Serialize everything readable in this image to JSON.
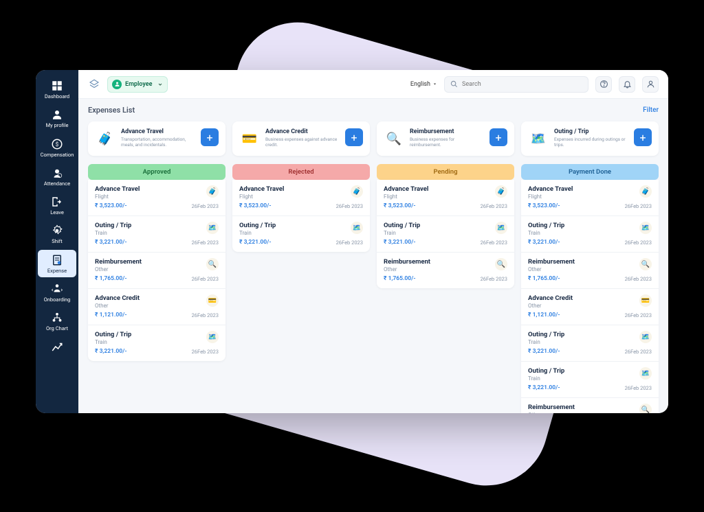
{
  "topbar": {
    "role": "Employee",
    "language": "English",
    "search_placeholder": "Search"
  },
  "sidebar": {
    "items": [
      {
        "label": "Dashboard"
      },
      {
        "label": "My profile"
      },
      {
        "label": "Compensation"
      },
      {
        "label": "Attendance"
      },
      {
        "label": "Leave"
      },
      {
        "label": "Shift"
      },
      {
        "label": "Expense"
      },
      {
        "label": "Onboarding"
      },
      {
        "label": "Org Chart"
      }
    ]
  },
  "page": {
    "title": "Expenses List",
    "filter": "Filter"
  },
  "categories": [
    {
      "title": "Advance Travel",
      "desc": "Transportation, accommodation, meals, and incidentals."
    },
    {
      "title": "Advance Credit",
      "desc": "Business expenses against advance credit."
    },
    {
      "title": "Reimbursement",
      "desc": "Business expenses for reimbursement."
    },
    {
      "title": "Outing / Trip",
      "desc": "Expenses incurred during outings or trips."
    }
  ],
  "columns": [
    {
      "name": "Approved",
      "items": [
        {
          "title": "Advance Travel",
          "sub": "Flight",
          "amount": "₹ 3,523.00/-",
          "date": "26Feb 2023"
        },
        {
          "title": "Outing / Trip",
          "sub": "Train",
          "amount": "₹ 3,221.00/-",
          "date": "26Feb 2023"
        },
        {
          "title": "Reimbursement",
          "sub": "Other",
          "amount": "₹ 1,765.00/-",
          "date": "26Feb 2023"
        },
        {
          "title": "Advance Credit",
          "sub": "Other",
          "amount": "₹ 1,121.00/-",
          "date": "26Feb 2023"
        },
        {
          "title": "Outing / Trip",
          "sub": "Train",
          "amount": "₹ 3,221.00/-",
          "date": "26Feb 2023"
        }
      ]
    },
    {
      "name": "Rejected",
      "items": [
        {
          "title": "Advance Travel",
          "sub": "Flight",
          "amount": "₹ 3,523.00/-",
          "date": "26Feb 2023"
        },
        {
          "title": "Outing / Trip",
          "sub": "Train",
          "amount": "₹ 3,221.00/-",
          "date": "26Feb 2023"
        }
      ]
    },
    {
      "name": "Pending",
      "items": [
        {
          "title": "Advance Travel",
          "sub": "Flight",
          "amount": "₹ 3,523.00/-",
          "date": "26Feb 2023"
        },
        {
          "title": "Outing / Trip",
          "sub": "Train",
          "amount": "₹ 3,221.00/-",
          "date": "26Feb 2023"
        },
        {
          "title": "Reimbursement",
          "sub": "Other",
          "amount": "₹ 1,765.00/-",
          "date": "26Feb 2023"
        }
      ]
    },
    {
      "name": "Payment Done",
      "items": [
        {
          "title": "Advance Travel",
          "sub": "Flight",
          "amount": "₹ 3,523.00/-",
          "date": "26Feb 2023"
        },
        {
          "title": "Outing / Trip",
          "sub": "Train",
          "amount": "₹ 3,221.00/-",
          "date": "26Feb 2023"
        },
        {
          "title": "Reimbursement",
          "sub": "Other",
          "amount": "₹ 1,765.00/-",
          "date": "26Feb 2023"
        },
        {
          "title": "Advance Credit",
          "sub": "Other",
          "amount": "₹ 1,121.00/-",
          "date": "26Feb 2023"
        },
        {
          "title": "Outing / Trip",
          "sub": "Train",
          "amount": "₹ 3,221.00/-",
          "date": "26Feb 2023"
        },
        {
          "title": "Outing / Trip",
          "sub": "Train",
          "amount": "₹ 3,221.00/-",
          "date": "26Feb 2023"
        },
        {
          "title": "Reimbursement",
          "sub": "Other",
          "amount": "",
          "date": ""
        }
      ]
    }
  ]
}
